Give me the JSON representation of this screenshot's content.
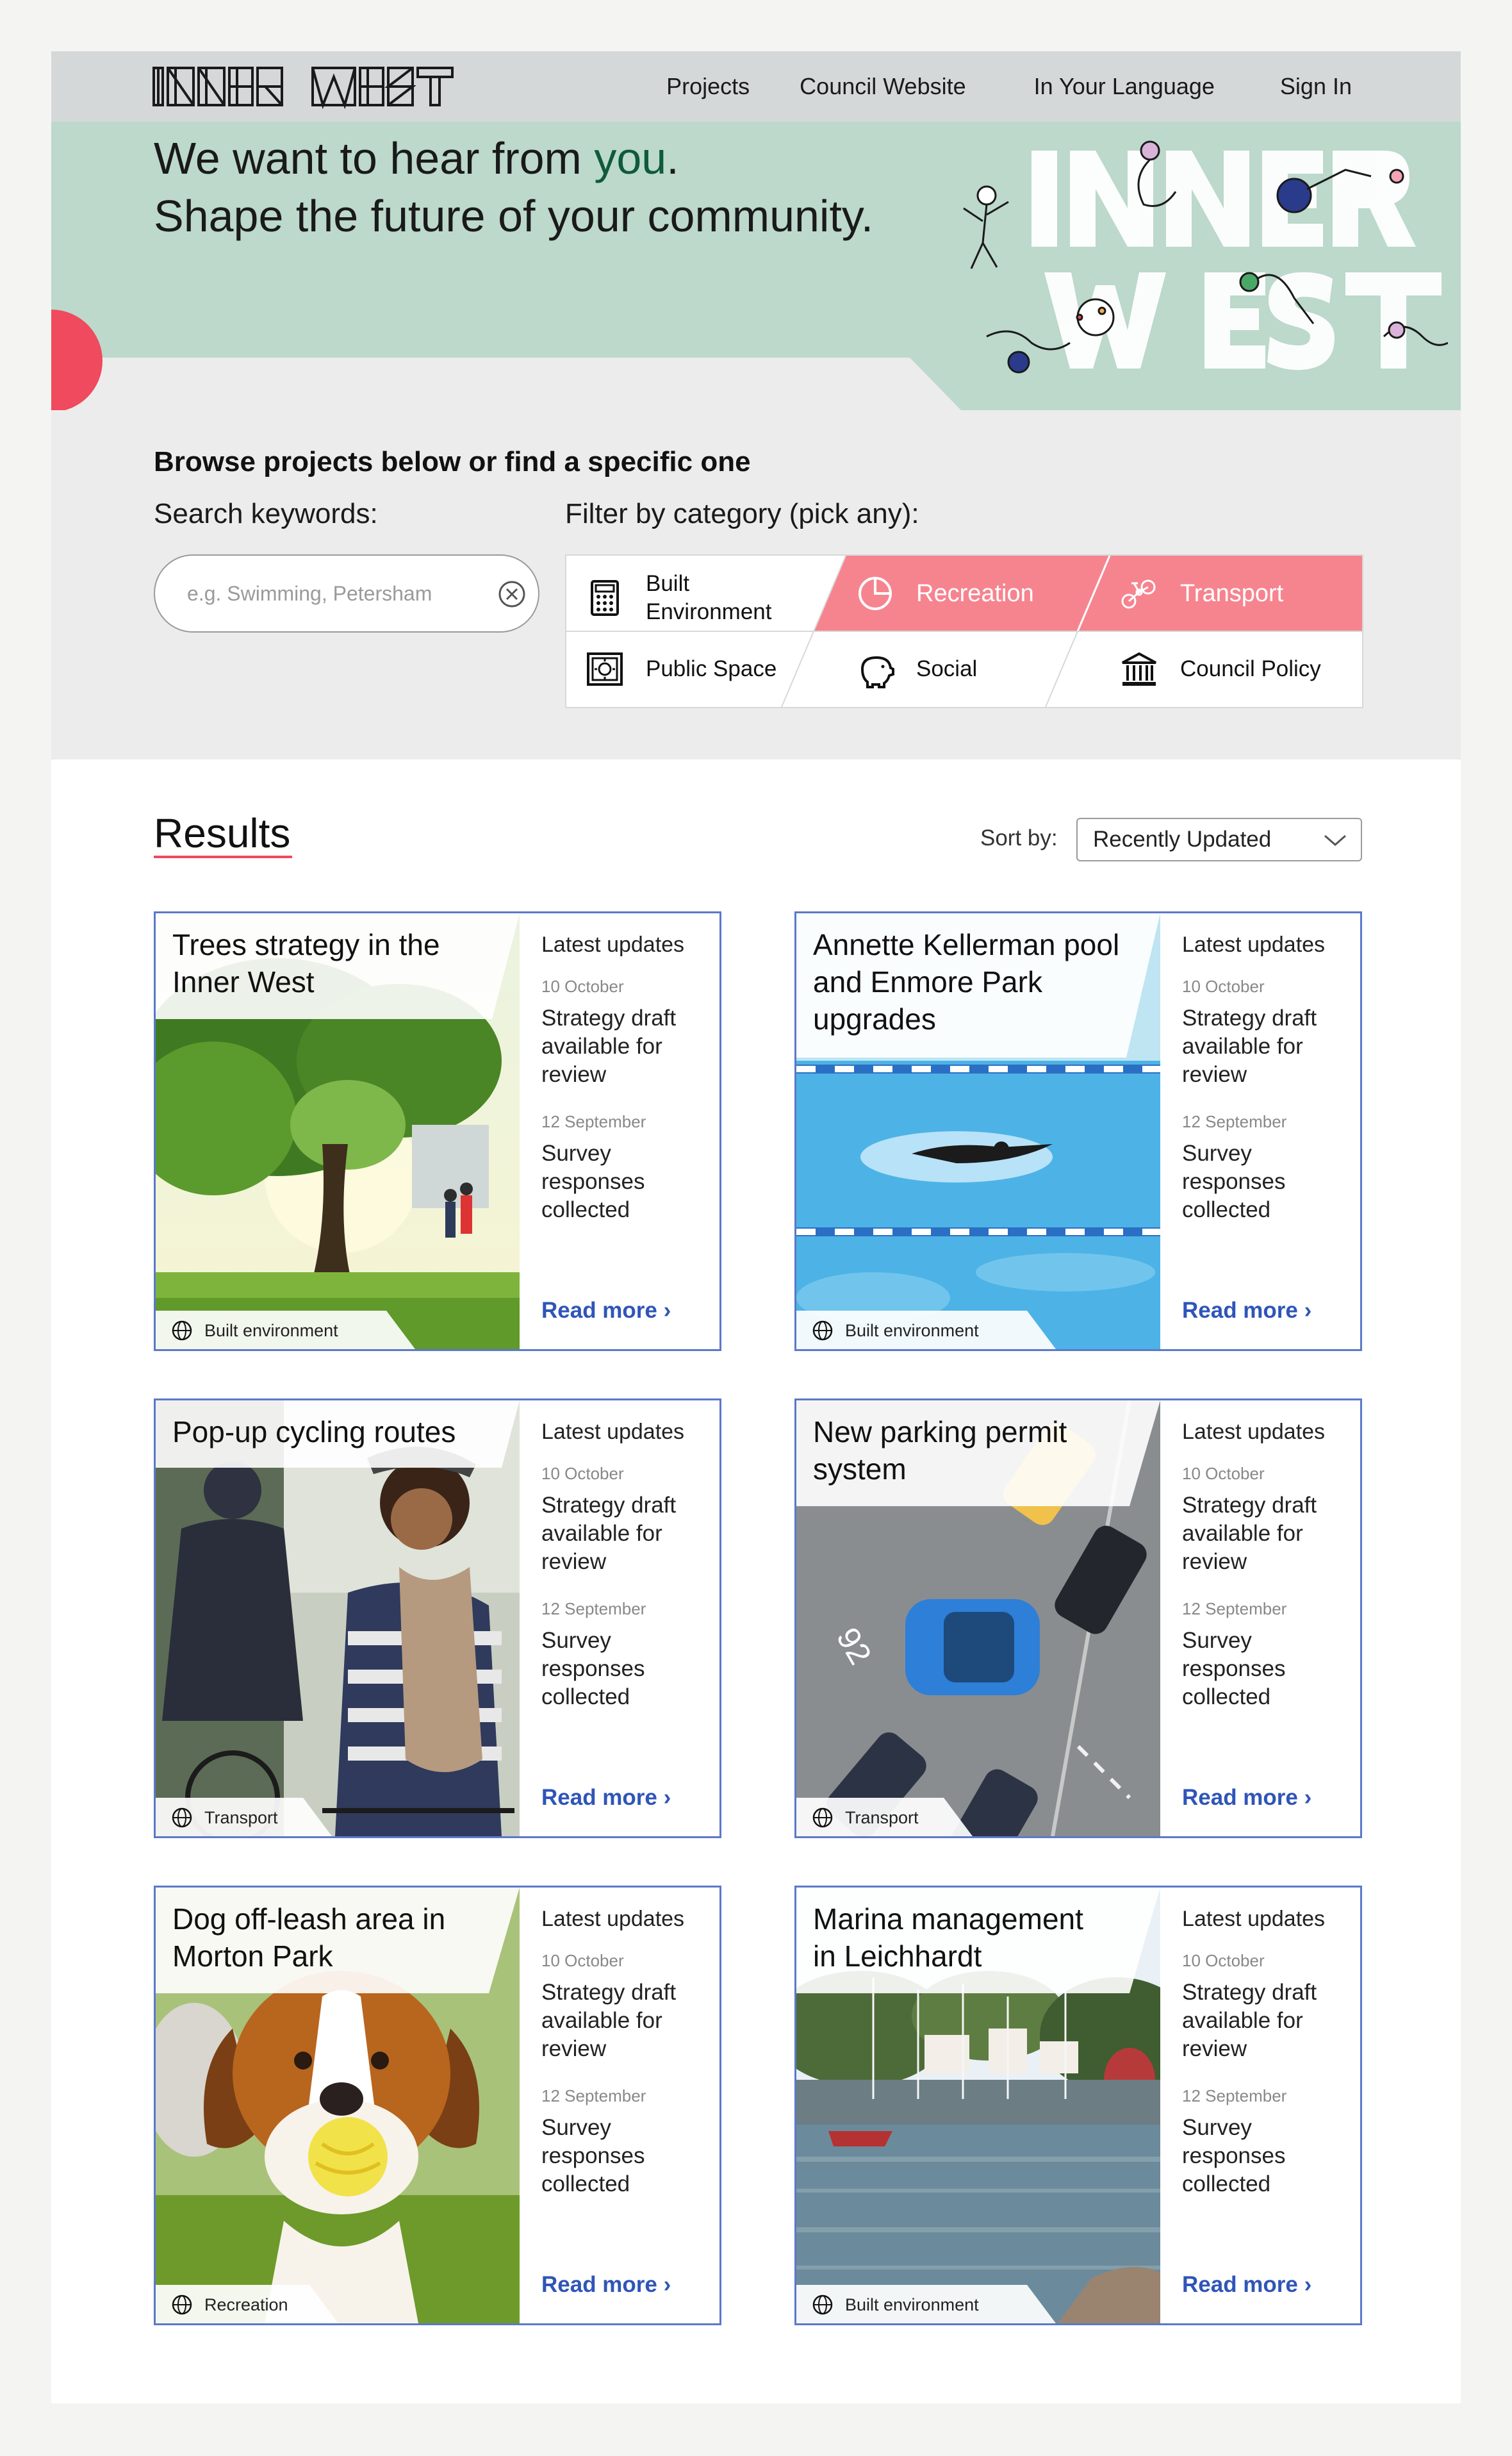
{
  "nav": {
    "logo_text": "INNER WEST",
    "links": [
      "Projects",
      "Council Website",
      "In Your Language",
      "Sign In"
    ]
  },
  "hero": {
    "line1_prefix": "We want to hear from ",
    "line1_accent": "you",
    "line1_suffix": ".",
    "line2": "Shape the future of your community.",
    "art_text": "INNER WEST"
  },
  "browse": {
    "title": "Browse projects below or find a specific one",
    "search_label": "Search keywords:",
    "search_placeholder": "e.g. Swimming, Petersham",
    "filter_label": "Filter by category (pick any):",
    "categories": [
      {
        "label_line1": "Built",
        "label_line2": "Environment",
        "icon": "calculator-icon",
        "selected": false
      },
      {
        "label": "Recreation",
        "icon": "pie-chart-icon",
        "selected": true
      },
      {
        "label": "Transport",
        "icon": "bicycle-icon",
        "selected": true
      },
      {
        "label": "Public Space",
        "icon": "safe-icon",
        "selected": false
      },
      {
        "label": "Social",
        "icon": "piggy-bank-icon",
        "selected": false
      },
      {
        "label": "Council Policy",
        "icon": "building-icon",
        "selected": false
      }
    ]
  },
  "results": {
    "title": "Results",
    "sort_label": "Sort by:",
    "sort_value": "Recently Updated",
    "cards": [
      {
        "title": "Trees strategy in the Inner West",
        "tag": "Built environment",
        "updates_label": "Latest updates",
        "date1": "10 October",
        "text1": "Strategy draft available for review",
        "date2": "12 September",
        "text2": "Survey responses collected",
        "read_more": "Read more ›"
      },
      {
        "title": "Annette Kellerman pool and Enmore Park upgrades",
        "tag": "Built environment",
        "updates_label": "Latest updates",
        "date1": "10 October",
        "text1": "Strategy draft available for review",
        "date2": "12 September",
        "text2": "Survey responses collected",
        "read_more": "Read more ›"
      },
      {
        "title": "Pop-up cycling routes",
        "tag": "Transport",
        "updates_label": "Latest updates",
        "date1": "10 October",
        "text1": "Strategy draft available for review",
        "date2": "12 September",
        "text2": "Survey responses collected",
        "read_more": "Read more ›"
      },
      {
        "title": "New parking permit system",
        "tag": "Transport",
        "updates_label": "Latest updates",
        "date1": "10 October",
        "text1": "Strategy draft available for review",
        "date2": "12 September",
        "text2": "Survey responses collected",
        "read_more": "Read more ›"
      },
      {
        "title": "Dog off-leash area in Morton Park",
        "tag": "Recreation",
        "updates_label": "Latest updates",
        "date1": "10 October",
        "text1": "Strategy draft available for review",
        "date2": "12 September",
        "text2": "Survey responses collected",
        "read_more": "Read more ›"
      },
      {
        "title": "Marina management in Leichhardt",
        "tag": "Built environment",
        "updates_label": "Latest updates",
        "date1": "10 October",
        "text1": "Strategy draft available for review",
        "date2": "12 September",
        "text2": "Survey responses collected",
        "read_more": "Read more ›"
      }
    ]
  },
  "colors": {
    "hero_bg": "#bcd9cb",
    "accent_red": "#ef4a5d",
    "selected_category": "#f6848f",
    "card_border": "#5b79c9",
    "link_blue": "#2f55b8",
    "accent_green": "#0f5a3c"
  }
}
